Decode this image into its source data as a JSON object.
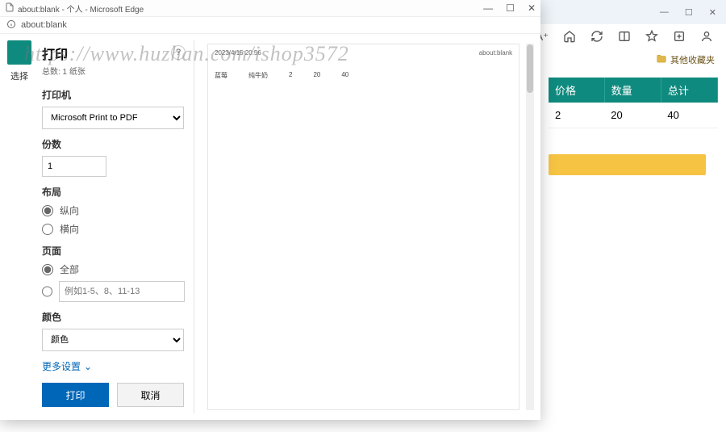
{
  "main_window": {
    "toolbar_icons": [
      "text-size",
      "home",
      "refresh",
      "panel",
      "favorites",
      "collections",
      "profile"
    ],
    "fav_label": "其他收藏夹"
  },
  "table": {
    "headers": [
      "价格",
      "数量",
      "总计"
    ],
    "row": [
      "2",
      "20",
      "40"
    ]
  },
  "dialog_window": {
    "title": "about:blank - 个人 - Microsoft Edge",
    "address": "about:blank"
  },
  "left_strip": {
    "select_label": "选择"
  },
  "print": {
    "title": "打印",
    "subtitle": "总数: 1 纸张",
    "printer_label": "打印机",
    "printer_value": "Microsoft Print to PDF",
    "copies_label": "份数",
    "copies_value": "1",
    "layout_label": "布局",
    "layout_portrait": "纵向",
    "layout_landscape": "横向",
    "pages_label": "页面",
    "pages_all": "全部",
    "pages_custom_placeholder": "例如1-5、8、11-13",
    "color_label": "颜色",
    "color_value": "颜色",
    "more_settings": "更多设置",
    "print_btn": "打印",
    "cancel_btn": "取消"
  },
  "preview": {
    "timestamp": "2023/4/15 20:56",
    "page_title": "about:blank",
    "mini_cols": [
      "蓝莓",
      "纯牛奶",
      "2",
      "20",
      "40"
    ]
  },
  "watermark": "https://www.huzhan.com/ishop3572"
}
